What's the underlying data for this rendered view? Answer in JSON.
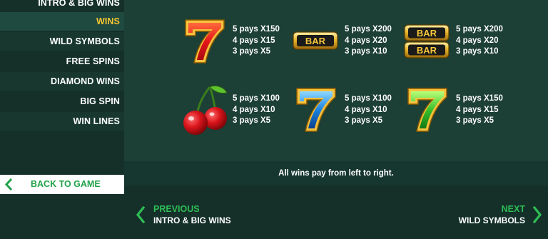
{
  "sidebar": {
    "items": [
      {
        "label": "INTRO & BIG WINS"
      },
      {
        "label": "WINS"
      },
      {
        "label": "WILD SYMBOLS"
      },
      {
        "label": "FREE SPINS"
      },
      {
        "label": "DIAMOND WINS"
      },
      {
        "label": "BIG SPIN"
      },
      {
        "label": "WIN LINES"
      }
    ],
    "back_label": "BACK TO GAME"
  },
  "paytable": {
    "red_seven": [
      "5 pays X150",
      "4 pays X15",
      "3 pays X5"
    ],
    "single_bar": [
      "5 pays X200",
      "4 pays X20",
      "3 pays X10"
    ],
    "double_bar": [
      "5 pays X200",
      "4 pays X20",
      "3 pays X10"
    ],
    "cherry": [
      "5 pays X100",
      "4 pays X10",
      "3 pays X5"
    ],
    "blue_seven": [
      "5 pays X100",
      "4 pays X10",
      "3 pays X5"
    ],
    "green_seven": [
      "5 pays X150",
      "4 pays X15",
      "3 pays X5"
    ],
    "bar_text": "BAR",
    "seven_glyph": "7"
  },
  "notice": "All wins pay from left to right.",
  "nav": {
    "previous_label": "PREVIOUS",
    "previous_target": "INTRO & BIG WINS",
    "next_label": "NEXT",
    "next_target": "WILD SYMBOLS"
  },
  "colors": {
    "background": "#1c3f36",
    "sidebar": "#143029",
    "active_item": "#f7c531",
    "accent_green": "#2fbd55"
  }
}
